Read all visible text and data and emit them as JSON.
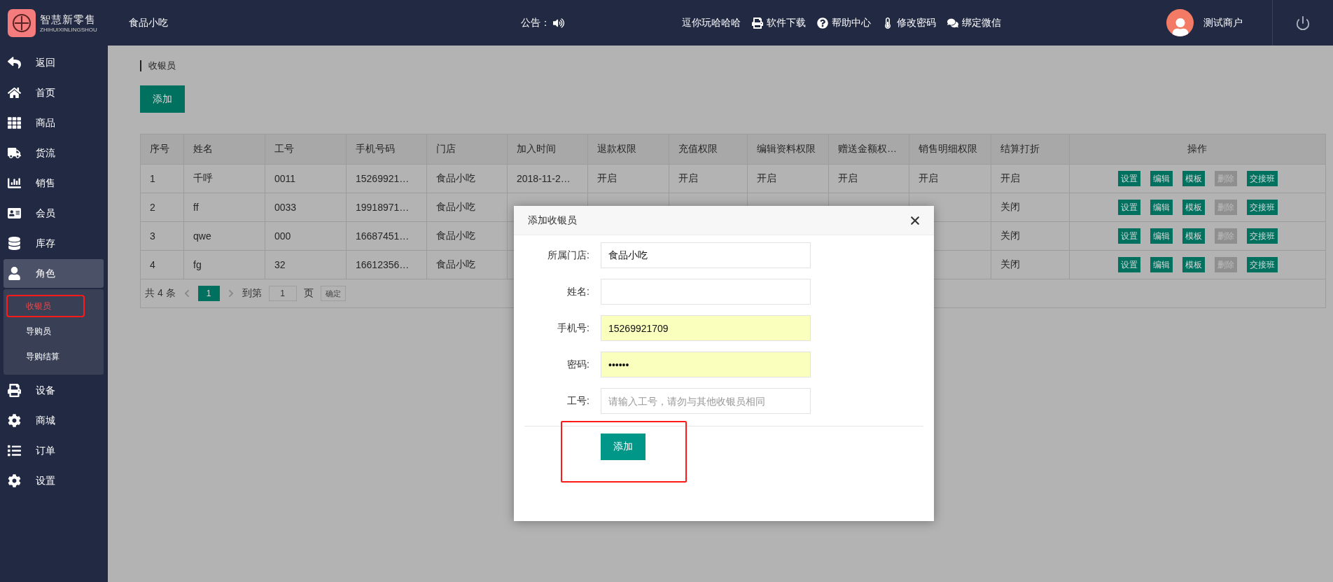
{
  "header": {
    "logo": {
      "title": "智慧新零售",
      "subtitle": "ZHIHUIXINLINGSHOU"
    },
    "store": "食品小吃",
    "notice_label": "公告：",
    "notice_text": "逗你玩哈哈哈",
    "links": [
      {
        "label": "软件下载"
      },
      {
        "label": "帮助中心"
      },
      {
        "label": "修改密码"
      },
      {
        "label": "绑定微信"
      }
    ],
    "user": "测试商户"
  },
  "sidebar": {
    "items": [
      {
        "label": "返回",
        "expanded": false
      },
      {
        "label": "首页",
        "expanded": false
      },
      {
        "label": "商品",
        "expanded": false
      },
      {
        "label": "货流",
        "expanded": false
      },
      {
        "label": "销售",
        "expanded": false
      },
      {
        "label": "会员",
        "expanded": false
      },
      {
        "label": "库存",
        "expanded": false
      },
      {
        "label": "角色",
        "expanded": true,
        "children": [
          {
            "label": "收银员",
            "selected": true,
            "annotated": true
          },
          {
            "label": "导购员",
            "selected": false,
            "annotated": false
          },
          {
            "label": "导购结算",
            "selected": false,
            "annotated": false
          }
        ]
      },
      {
        "label": "设备",
        "expanded": false
      },
      {
        "label": "商城",
        "expanded": false
      },
      {
        "label": "订单",
        "expanded": false
      },
      {
        "label": "设置",
        "expanded": false
      }
    ]
  },
  "breadcrumb": "收银员",
  "add_button": "添加",
  "table": {
    "columns": [
      "序号",
      "姓名",
      "工号",
      "手机号码",
      "门店",
      "加入时间",
      "退款权限",
      "充值权限",
      "编辑资料权限",
      "赠送金额权…",
      "销售明细权限",
      "结算打折",
      "操作"
    ],
    "rows": [
      {
        "cells": [
          "1",
          "千呼",
          "0011",
          "15269921…",
          "食品小吃",
          "2018-11-2…",
          "开启",
          "开启",
          "开启",
          "开启",
          "开启",
          "开启"
        ],
        "actions": [
          {
            "label": "设置",
            "disabled": false
          },
          {
            "label": "编辑",
            "disabled": false
          },
          {
            "label": "模板",
            "disabled": false
          },
          {
            "label": "删除",
            "disabled": true
          },
          {
            "label": "交接班",
            "disabled": false
          }
        ]
      },
      {
        "cells": [
          "2",
          "ff",
          "0033",
          "19918971…",
          "食品小吃",
          null,
          null,
          null,
          null,
          null,
          null,
          "关闭"
        ],
        "actions": [
          {
            "label": "设置",
            "disabled": false
          },
          {
            "label": "编辑",
            "disabled": false
          },
          {
            "label": "模板",
            "disabled": false
          },
          {
            "label": "删除",
            "disabled": true
          },
          {
            "label": "交接班",
            "disabled": false
          }
        ]
      },
      {
        "cells": [
          "3",
          "qwe",
          "000",
          "16687451…",
          "食品小吃",
          null,
          null,
          null,
          null,
          null,
          null,
          "关闭"
        ],
        "actions": [
          {
            "label": "设置",
            "disabled": false
          },
          {
            "label": "编辑",
            "disabled": false
          },
          {
            "label": "模板",
            "disabled": false
          },
          {
            "label": "删除",
            "disabled": true
          },
          {
            "label": "交接班",
            "disabled": false
          }
        ]
      },
      {
        "cells": [
          "4",
          "fg",
          "32",
          "16612356…",
          "食品小吃",
          null,
          null,
          null,
          null,
          null,
          null,
          "关闭"
        ],
        "actions": [
          {
            "label": "设置",
            "disabled": false
          },
          {
            "label": "编辑",
            "disabled": false
          },
          {
            "label": "模板",
            "disabled": false
          },
          {
            "label": "删除",
            "disabled": true
          },
          {
            "label": "交接班",
            "disabled": false
          }
        ]
      }
    ]
  },
  "pagination": {
    "summary": "共 4 条",
    "pages": [
      {
        "label": "1",
        "selected": true
      }
    ],
    "goto_label": "到第",
    "goto_value": "1",
    "page_unit": "页",
    "confirm": "确定"
  },
  "dialog": {
    "title": "添加收银员",
    "fields": [
      {
        "label": "所属门店:",
        "value": "食品小吃",
        "autofilled": false
      },
      {
        "label": "姓名:",
        "autofilled": false
      },
      {
        "label": "手机号:",
        "value": "15269921709",
        "autofilled": true
      },
      {
        "label": "密码:",
        "value": "••••••",
        "autofilled": true
      },
      {
        "label": "工号:",
        "placeholder": "请输入工号，请勿与其他收银员相同",
        "autofilled": false
      }
    ],
    "submit": "添加",
    "submit_annotated": true
  }
}
